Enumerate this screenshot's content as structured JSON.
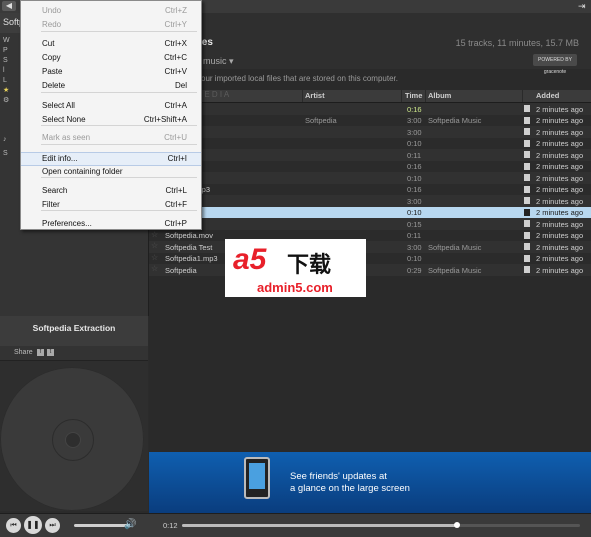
{
  "window": {
    "title": "Softp",
    "back_icon": "back-arrow-icon",
    "fullscreen_icon": "exit-icon"
  },
  "sidebar": {
    "icons": [
      "W",
      "P",
      "S",
      "l",
      "L",
      "★",
      "⚙",
      "♪",
      "S"
    ]
  },
  "now_playing": {
    "title": "Softpedia Extraction",
    "share_label": "Share",
    "share_icons": [
      "f",
      "t"
    ]
  },
  "header": {
    "title": "les",
    "meta": "15 tracks, 11 minutes, 15.7 MB",
    "filter": "music ▾",
    "partner_logo": "POWERED BY gracenote",
    "description": "our imported local files that are stored on this computer.",
    "watermark_text": "S O F T P E D I A"
  },
  "columns": {
    "artist": "Artist",
    "time": "Time",
    "album": "Album",
    "added": "Added"
  },
  "tracks": [
    {
      "title": "xtraction",
      "artist": "",
      "time": "0:16",
      "album": "",
      "added": "2 minutes ago",
      "state": "playing"
    },
    {
      "title": "est",
      "artist": "Softpedia",
      "time": "3:00",
      "album": "Softpedia Music",
      "added": "2 minutes ago",
      "state": ""
    },
    {
      "title": "est_1.mp3",
      "artist": "",
      "time": "3:00",
      "album": "",
      "added": "2 minutes ago",
      "state": ""
    },
    {
      "title": "gp",
      "artist": "",
      "time": "0:10",
      "album": "",
      "added": "2 minutes ago",
      "state": ""
    },
    {
      "title": "nov",
      "artist": "",
      "time": "0:11",
      "album": "",
      "added": "2 minutes ago",
      "state": ""
    },
    {
      "title": "np3",
      "artist": "",
      "time": "0:16",
      "album": "",
      "added": "2 minutes ago",
      "state": ""
    },
    {
      "title": "mp3",
      "artist": "",
      "time": "0:10",
      "album": "",
      "added": "2 minutes ago",
      "state": ""
    },
    {
      "title": "xtraction.mp3",
      "artist": "",
      "time": "0:16",
      "album": "",
      "added": "2 minutes ago",
      "state": ""
    },
    {
      "title": "est.mp3",
      "artist": "",
      "time": "3:00",
      "album": "",
      "added": "2 minutes ago",
      "state": ""
    },
    {
      "title": "gp",
      "artist": "",
      "time": "0:10",
      "album": "",
      "added": "2 minutes ago",
      "state": "selected"
    },
    {
      "title": "oftpedia",
      "artist": "",
      "time": "0:15",
      "album": "",
      "added": "2 minutes ago",
      "state": ""
    },
    {
      "title": "Softpedia.mov",
      "artist": "",
      "time": "0:11",
      "album": "",
      "added": "2 minutes ago",
      "state": ""
    },
    {
      "title": "Softpedia Test",
      "artist": "",
      "time": "3:00",
      "album": "Softpedia Music",
      "added": "2 minutes ago",
      "state": ""
    },
    {
      "title": "Softpedia1.mp3",
      "artist": "",
      "time": "0:10",
      "album": "",
      "added": "2 minutes ago",
      "state": ""
    },
    {
      "title": "Softpedia",
      "artist": "",
      "time": "0:29",
      "album": "Softpedia Music",
      "added": "2 minutes ago",
      "state": ""
    }
  ],
  "context_menu": {
    "items": [
      {
        "label": "Undo",
        "shortcut": "Ctrl+Z",
        "disabled": true
      },
      {
        "label": "Redo",
        "shortcut": "Ctrl+Y",
        "disabled": true
      },
      {
        "label": "Cut",
        "shortcut": "Ctrl+X",
        "disabled": false
      },
      {
        "label": "Copy",
        "shortcut": "Ctrl+C",
        "disabled": false
      },
      {
        "label": "Paste",
        "shortcut": "Ctrl+V",
        "disabled": false
      },
      {
        "label": "Delete",
        "shortcut": "Del",
        "disabled": false
      },
      {
        "label": "Select All",
        "shortcut": "Ctrl+A",
        "disabled": false
      },
      {
        "label": "Select None",
        "shortcut": "Ctrl+Shift+A",
        "disabled": false
      },
      {
        "label": "Mark as seen",
        "shortcut": "Ctrl+U",
        "disabled": true
      },
      {
        "label": "Edit info...",
        "shortcut": "Ctrl+I",
        "disabled": false,
        "highlighted": true
      },
      {
        "label": "Open containing folder",
        "shortcut": "",
        "disabled": false
      },
      {
        "label": "Search",
        "shortcut": "Ctrl+L",
        "disabled": false
      },
      {
        "label": "Filter",
        "shortcut": "Ctrl+F",
        "disabled": false
      },
      {
        "label": "Preferences...",
        "shortcut": "Ctrl+P",
        "disabled": false
      }
    ]
  },
  "ad": {
    "line1": "See friends' updates at",
    "line2": "a glance on the large screen"
  },
  "player": {
    "elapsed": "0:12",
    "progress_fraction": 0.69,
    "prev_icon": "prev-icon",
    "play_icon": "pause-icon",
    "next_icon": "next-icon",
    "volume_icon": "speaker-icon"
  },
  "overlay_watermark": {
    "logo_text": "a5",
    "cn_text": "下载",
    "url": "admin5.com"
  },
  "colors": {
    "accent_playing": "#cde88a",
    "selection": "#b7d7ef",
    "ad_blue": "#0f5fb0",
    "watermark_red": "#e8202a"
  }
}
